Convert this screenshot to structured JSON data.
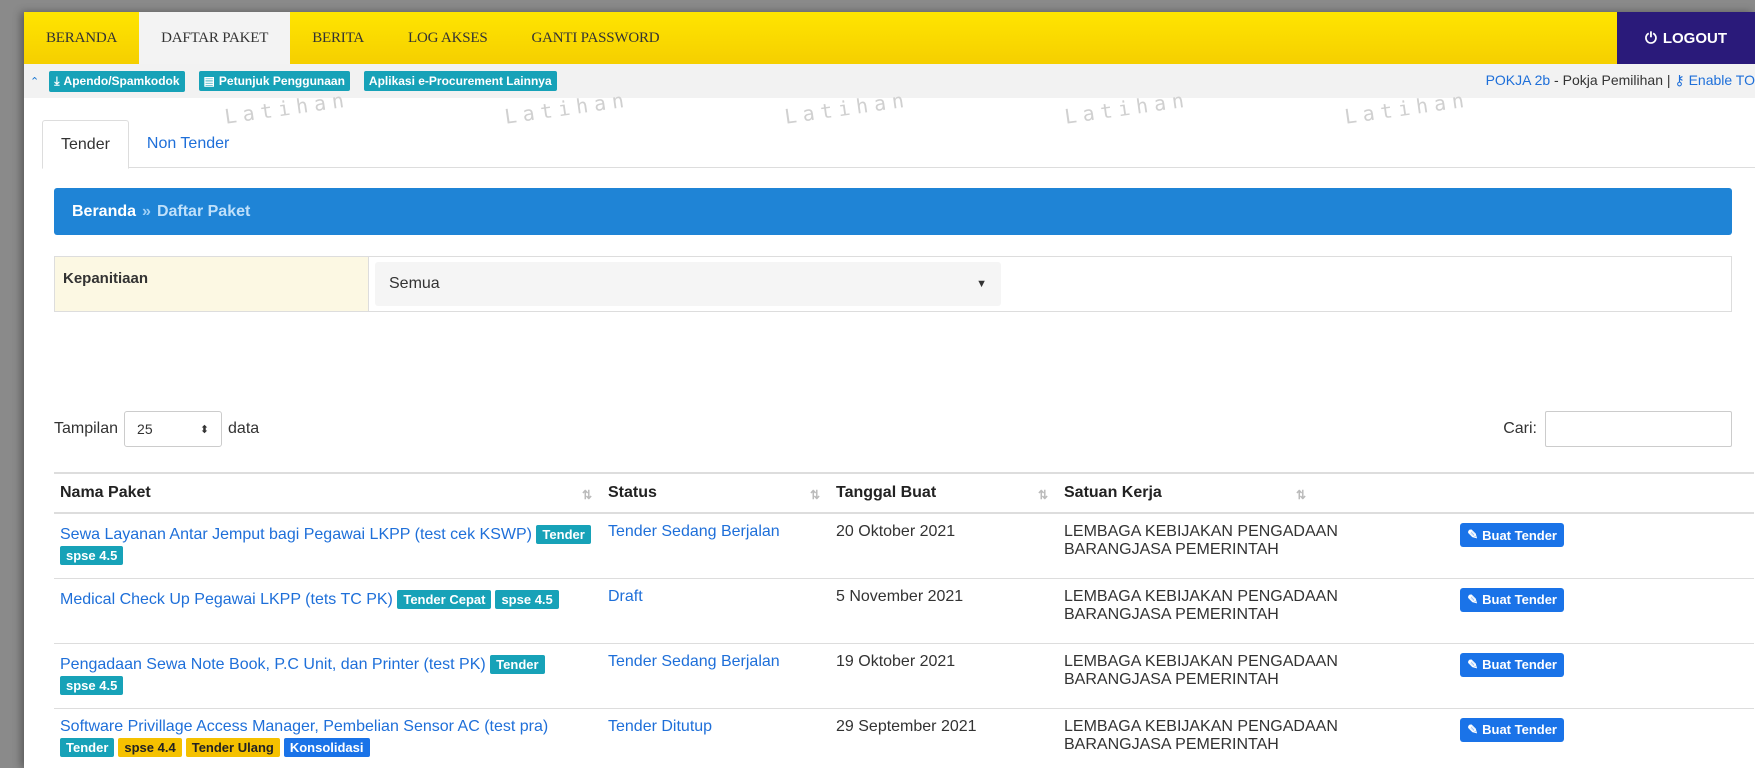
{
  "nav": {
    "items": [
      "BERANDA",
      "DAFTAR PAKET",
      "BERITA",
      "LOG AKSES",
      "GANTI PASSWORD"
    ],
    "active_index": 1,
    "logout": "LOGOUT"
  },
  "subbar": {
    "buttons": [
      "Apendo/Spamkodok",
      "Petunjuk Penggunaan",
      "Aplikasi e-Procurement Lainnya"
    ],
    "user_role": "POKJA 2b",
    "user_sep": " - Pokja Pemilihan | ",
    "enable_link": "Enable TO"
  },
  "watermark": "Latihan",
  "tabs": [
    "Tender",
    "Non Tender"
  ],
  "breadcrumb": {
    "root": "Beranda",
    "sep": "»",
    "current": "Daftar Paket"
  },
  "filter": {
    "label": "Kepanitiaan",
    "value": "Semua"
  },
  "controls": {
    "show_label": "Tampilan",
    "show_value": "25",
    "data_label": "data",
    "search_label": "Cari:"
  },
  "table": {
    "headers": [
      "Nama Paket",
      "Status",
      "Tanggal Buat",
      "Satuan Kerja",
      ""
    ],
    "rows": [
      {
        "name": "Sewa Layanan Antar Jemput bagi Pegawai LKPP (test cek KSWP)",
        "badges": [
          {
            "text": "Tender",
            "color": "teal"
          },
          {
            "text": "spse 4.5",
            "color": "teal"
          }
        ],
        "status": "Tender Sedang Berjalan",
        "date": "20 Oktober 2021",
        "unit": "LEMBAGA KEBIJAKAN PENGADAAN BARANGJASA PEMERINTAH",
        "action": "Buat Tender"
      },
      {
        "name": "Medical Check Up Pegawai LKPP (tets TC PK)",
        "badges": [
          {
            "text": "Tender Cepat",
            "color": "teal"
          },
          {
            "text": "spse 4.5",
            "color": "teal"
          }
        ],
        "status": "Draft",
        "date": "5 November 2021",
        "unit": "LEMBAGA KEBIJAKAN PENGADAAN BARANGJASA PEMERINTAH",
        "action": "Buat Tender"
      },
      {
        "name": "Pengadaan Sewa Note Book, P.C Unit, dan Printer (test PK)",
        "badges": [
          {
            "text": "Tender",
            "color": "teal"
          },
          {
            "text": "spse 4.5",
            "color": "teal"
          }
        ],
        "status": "Tender Sedang Berjalan",
        "date": "19 Oktober 2021",
        "unit": "LEMBAGA KEBIJAKAN PENGADAAN BARANGJASA PEMERINTAH",
        "action": "Buat Tender"
      },
      {
        "name": "Software Privillage Access Manager, Pembelian Sensor AC (test pra)",
        "badges": [
          {
            "text": "Tender",
            "color": "teal"
          },
          {
            "text": "spse 4.4",
            "color": "yellow"
          },
          {
            "text": "Tender Ulang",
            "color": "yellow"
          },
          {
            "text": "Konsolidasi",
            "color": "blue"
          }
        ],
        "status": "Tender Ditutup",
        "date": "29 September 2021",
        "unit": "LEMBAGA KEBIJAKAN PENGADAAN BARANGJASA PEMERINTAH",
        "action": "Buat Tender"
      }
    ]
  }
}
